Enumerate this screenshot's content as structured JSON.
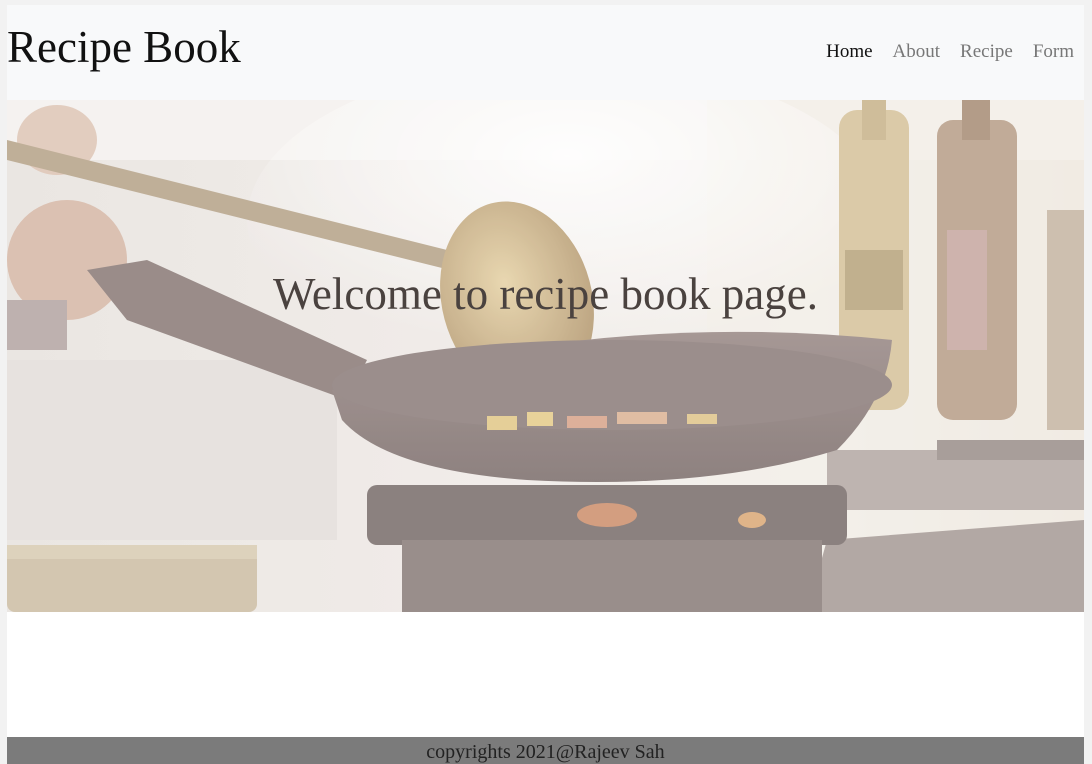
{
  "header": {
    "brand": "Recipe Book",
    "nav": [
      {
        "label": "Home",
        "active": true
      },
      {
        "label": "About",
        "active": false
      },
      {
        "label": "Recipe",
        "active": false
      },
      {
        "label": "Form",
        "active": false
      }
    ]
  },
  "hero": {
    "title": "Welcome to recipe book page.",
    "image": "chef stirring wok over flame (faded background photo)"
  },
  "footer": {
    "text": "copyrights 2021@Rajeev Sah"
  },
  "colors": {
    "navbar_bg": "#f8f9fa",
    "nav_active": "#111111",
    "nav_inactive": "#777777",
    "footer_bg": "#7b7b7b"
  }
}
